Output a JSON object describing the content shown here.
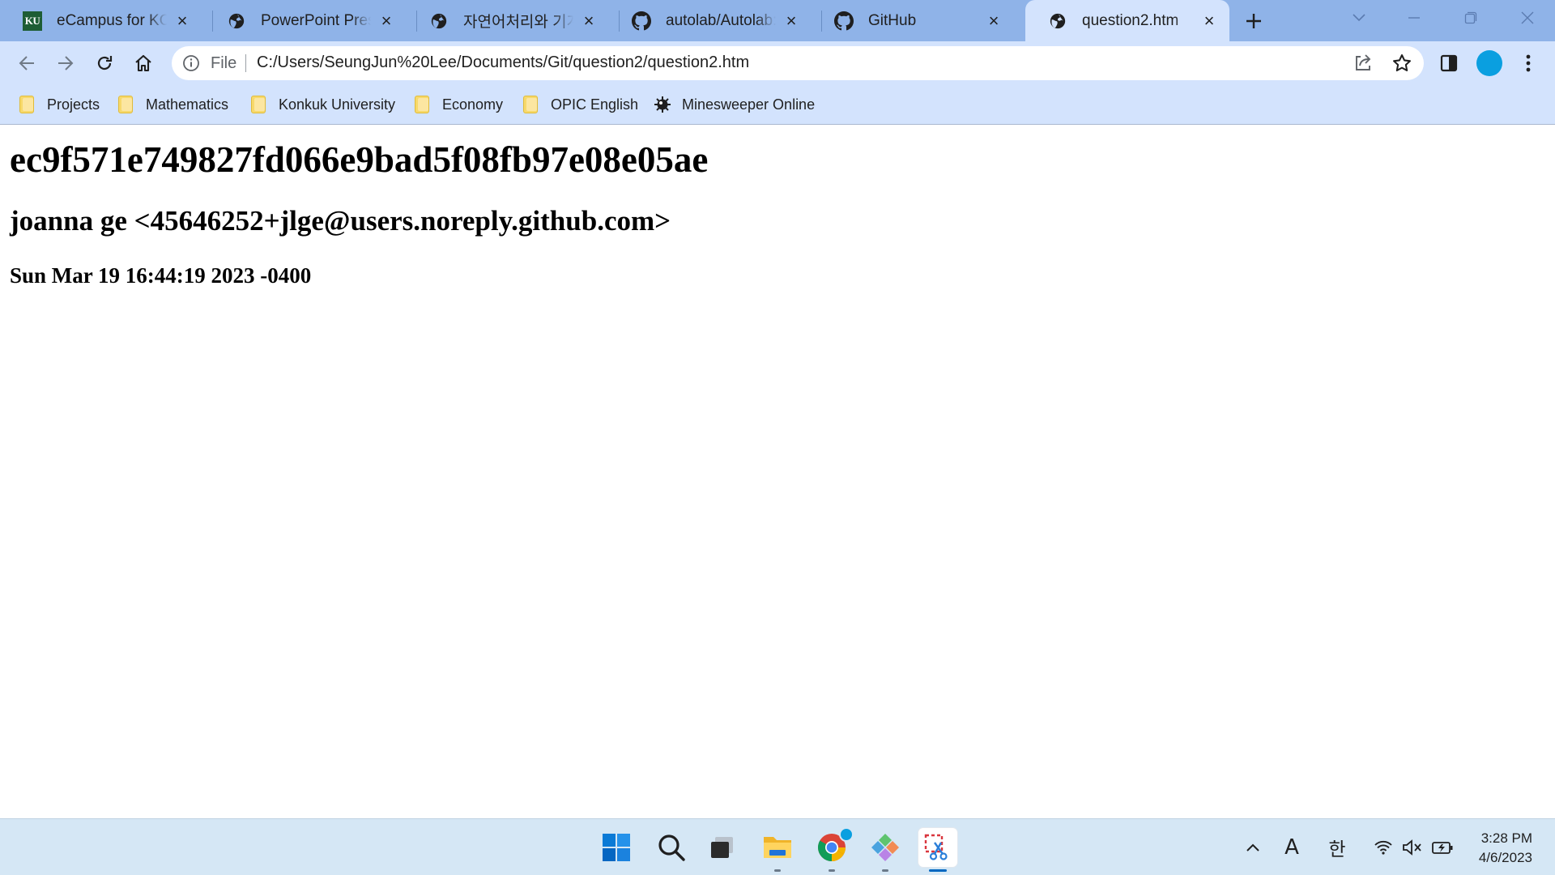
{
  "browser": {
    "tabs": [
      {
        "title": "eCampus for KONKUK",
        "favicon": "ku-logo-icon",
        "active": false
      },
      {
        "title": "PowerPoint Presentation",
        "favicon": "globe-icon",
        "active": false
      },
      {
        "title": "자연어처리와 기계학습",
        "favicon": "globe-icon",
        "active": false
      },
      {
        "title": "autolab/Autolab: Course",
        "favicon": "github-icon",
        "active": false
      },
      {
        "title": "GitHub",
        "favicon": "github-icon",
        "active": false
      },
      {
        "title": "question2.htm",
        "favicon": "globe-icon",
        "active": true
      }
    ],
    "omnibox": {
      "scheme_chip": "File",
      "url": "C:/Users/SeungJun%20Lee/Documents/Git/question2/question2.htm"
    },
    "bookmarks": [
      {
        "label": "Projects",
        "icon": "folder-icon"
      },
      {
        "label": "Mathematics",
        "icon": "folder-icon"
      },
      {
        "label": "Konkuk University",
        "icon": "folder-icon"
      },
      {
        "label": "Economy",
        "icon": "folder-icon"
      },
      {
        "label": "OPIC English",
        "icon": "folder-icon"
      },
      {
        "label": "Minesweeper Online",
        "icon": "minesweeper-icon"
      }
    ],
    "accent_color": "#8fb3e8",
    "toolbar_color": "#d3e3fd",
    "profile_color": "#0a9fe0"
  },
  "page": {
    "commit_hash": "ec9f571e749827fd066e9bad5f08fb97e08e05ae",
    "author": "joanna ge <45646252+jlge@users.noreply.github.com>",
    "date": "Sun Mar 19 16:44:19 2023 -0400"
  },
  "taskbar": {
    "apps": [
      "start-icon",
      "search-icon",
      "task-view-icon",
      "file-explorer-icon",
      "chrome-icon",
      "git-icon",
      "snipping-tool-icon"
    ],
    "active_app": "snipping-tool-icon",
    "tray": {
      "input_mode": "A",
      "ime": "한"
    },
    "clock": {
      "time": "3:28 PM",
      "date": "4/6/2023"
    }
  }
}
